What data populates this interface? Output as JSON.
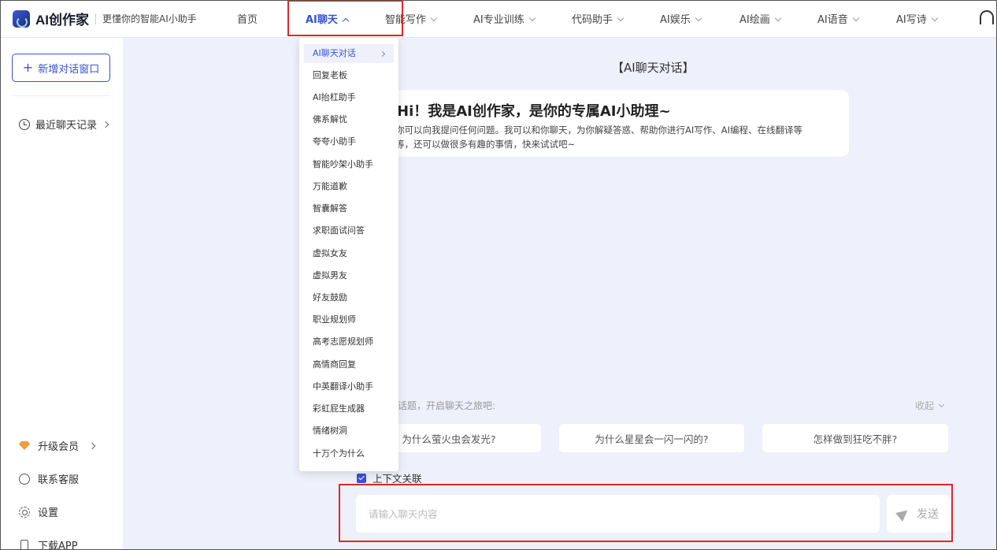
{
  "brand": {
    "name": "AI创作家",
    "slogan": "更懂你的智能AI小助手"
  },
  "nav": [
    {
      "label": "首页",
      "has_arrow": false
    },
    {
      "label": "AI聊天",
      "has_arrow": true,
      "active": true
    },
    {
      "label": "智能写作",
      "has_arrow": true
    },
    {
      "label": "AI专业训练",
      "has_arrow": true
    },
    {
      "label": "代码助手",
      "has_arrow": true
    },
    {
      "label": "AI娱乐",
      "has_arrow": true
    },
    {
      "label": "AI绘画",
      "has_arrow": true
    },
    {
      "label": "AI语音",
      "has_arrow": true
    },
    {
      "label": "AI写诗",
      "has_arrow": true
    }
  ],
  "sidebar": {
    "new_chat": "新增对话窗口",
    "recent": "最近聊天记录",
    "upgrade": "升级会员",
    "support": "联系客服",
    "settings": "设置",
    "download": "下载APP"
  },
  "dropdown": [
    "AI聊天对话",
    "回复老板",
    "AI抬杠助手",
    "佛系解忧",
    "夸夸小助手",
    "智能吵架小助手",
    "万能道歉",
    "智囊解答",
    "求职面试问答",
    "虚拟女友",
    "虚拟男友",
    "好友鼓励",
    "职业规划师",
    "高考志愿规划师",
    "高情商回复",
    "中英翻译小助手",
    "彩虹屁生成器",
    "情绪树洞",
    "十万个为什么"
  ],
  "main": {
    "title": "【AI聊天对话】",
    "welcome_title": "Hi！我是AI创作家，是你的专属AI小助理~",
    "welcome_line1": "你可以向我提问任何问题。我可以和你聊天，为你解疑答惑、帮助你进行AI写作、AI编程、在线翻译等",
    "welcome_line2": "等，还可以做很多有趣的事情，快来试试吧~",
    "suggest_head": "话题，开启聊天之旅吧:",
    "collapse": "收起",
    "suggestions": [
      "为什么萤火虫会发光?",
      "为什么星星会一闪一闪的?",
      "怎样做到狂吃不胖?"
    ],
    "context_label": "上下文关联",
    "input_placeholder": "请输入聊天内容",
    "send": "发送"
  },
  "colors": {
    "accent": "#3751d9",
    "highlight": "#e0262c",
    "background": "#eef0fb"
  }
}
